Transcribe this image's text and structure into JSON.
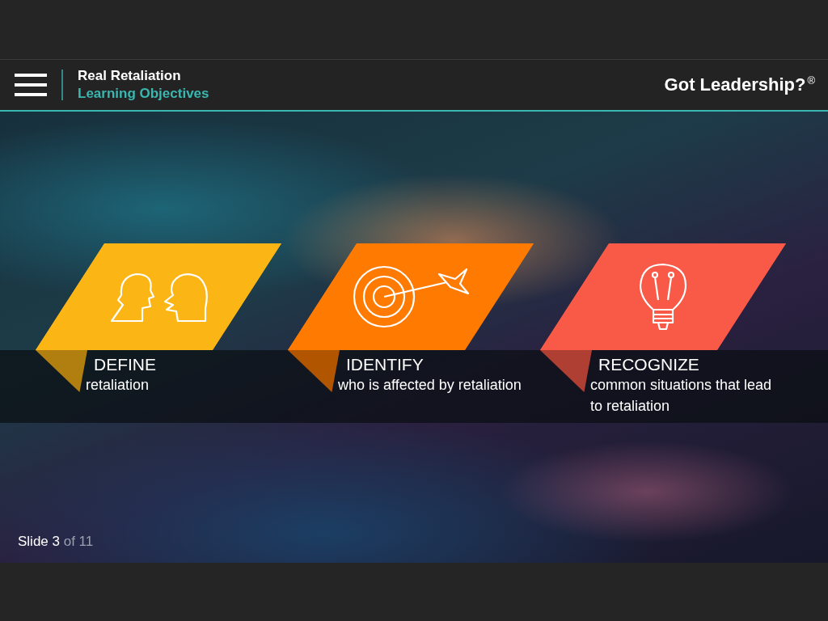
{
  "header": {
    "course_title": "Real Retaliation",
    "section_title": "Learning Objectives",
    "brand": "Got Leadership?",
    "brand_mark": "®"
  },
  "objectives": [
    {
      "kind": "heads",
      "color": "#fbb515",
      "heading": "DEFINE",
      "text": "retaliation"
    },
    {
      "kind": "target",
      "color": "#ff7a00",
      "heading": "IDENTIFY",
      "text": "who is affected by retaliation"
    },
    {
      "kind": "bulb",
      "color": "#f95a48",
      "heading": "RECOGNIZE",
      "text": "common situations that lead to retaliation"
    }
  ],
  "footer": {
    "current": "Slide 3",
    "total": "of 11"
  }
}
